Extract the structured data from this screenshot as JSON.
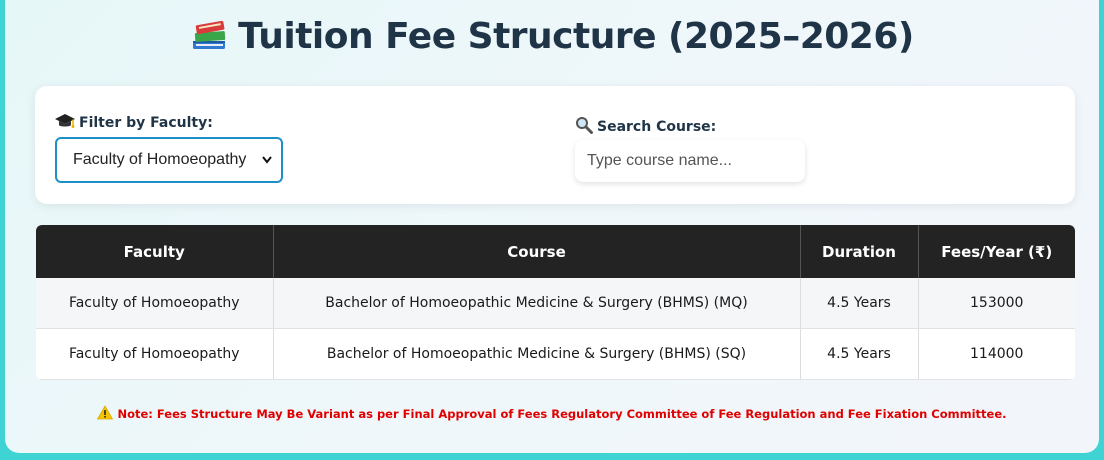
{
  "page": {
    "title": "Tuition Fee Structure (2025–2026)",
    "title_icon": "books-icon"
  },
  "filters": {
    "faculty_label": "Filter by Faculty:",
    "faculty_icon": "graduation-cap-icon",
    "faculty_selected": "Faculty of Homoeopathy",
    "search_label": "Search Course:",
    "search_icon": "magnifier-icon",
    "search_placeholder": "Type course name..."
  },
  "table": {
    "headers": [
      "Faculty",
      "Course",
      "Duration",
      "Fees/Year (₹)"
    ],
    "rows": [
      {
        "faculty": "Faculty of Homoeopathy",
        "course": "Bachelor of Homoeopathic Medicine & Surgery (BHMS) (MQ)",
        "duration": "4.5 Years",
        "fees": "153000"
      },
      {
        "faculty": "Faculty of Homoeopathy",
        "course": "Bachelor of Homoeopathic Medicine & Surgery (BHMS) (SQ)",
        "duration": "4.5 Years",
        "fees": "114000"
      }
    ]
  },
  "note": {
    "icon": "warning-icon",
    "text": "Note: Fees Structure May Be Variant as per Final Approval of Fees Regulatory Committee of Fee Regulation and Fee Fixation Committee."
  },
  "colors": {
    "accent": "#1e90c8",
    "header_bg": "#232323",
    "note_red": "#e00000",
    "frame_teal": "#3fd3d3"
  }
}
